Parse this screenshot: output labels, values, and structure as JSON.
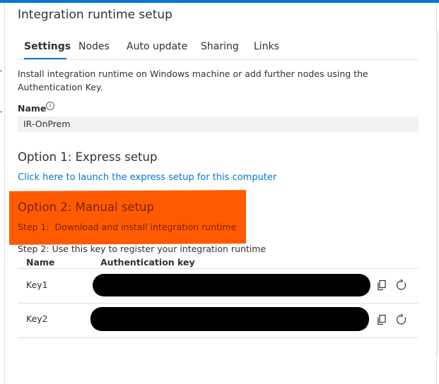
{
  "panel": {
    "title": "Integration runtime setup"
  },
  "tabs": [
    {
      "label": "Settings",
      "active": true
    },
    {
      "label": "Nodes",
      "active": false
    },
    {
      "label": "Auto update",
      "active": false
    },
    {
      "label": "Sharing",
      "active": false
    },
    {
      "label": "Links",
      "active": false
    }
  ],
  "settings": {
    "description": "Install integration runtime on Windows machine or add further nodes using the Authentication Key.",
    "name_label": "Name",
    "name_value": "IR-OnPrem",
    "option1_heading": "Option 1: Express setup",
    "express_link": "Click here to launch the express setup for this computer",
    "option2_heading": "Option 2: Manual setup",
    "step1": "Step 1:  Download and install integration runtime",
    "step2": "Step 2: Use this key to register your integration runtime"
  },
  "keys_table": {
    "headers": [
      "Name",
      "Authentication key"
    ],
    "rows": [
      {
        "name": "Key1",
        "key": ""
      },
      {
        "name": "Key2",
        "key": ""
      }
    ]
  },
  "colors": {
    "accent": "#0078d4",
    "highlight": "#ff5a00",
    "redaction": "#000000"
  },
  "icons": {
    "info": "info-icon",
    "copy": "copy-icon",
    "refresh": "refresh-icon"
  }
}
